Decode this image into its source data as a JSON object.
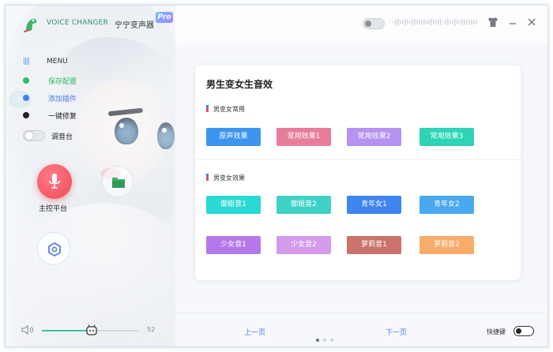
{
  "titlebar": {
    "app_name": "VOICE CHANGER",
    "app_cn": "宁宁变声器",
    "badge": "Pro",
    "top_toggle_on": false
  },
  "sidebar": {
    "menu_label": "MENU",
    "items": [
      {
        "label": "保存配置",
        "color": "#2dbb69"
      },
      {
        "label": "添加插件",
        "color": "#4c7cf0"
      },
      {
        "label": "一键修复",
        "color": "#222222"
      }
    ],
    "mixer_label": "调音台",
    "mixer_on": false,
    "main_control_label": "主控平台"
  },
  "volume": {
    "value": 52,
    "fill_fraction": 0.52
  },
  "panel": {
    "title": "男生变女生音效",
    "section1_title": "男变女常用",
    "section1_buttons": [
      {
        "label": "原声效果",
        "color": "#3d95f0"
      },
      {
        "label": "常用效果1",
        "color": "#e87d9a"
      },
      {
        "label": "常用效果2",
        "color": "#b693f0"
      },
      {
        "label": "常用效果3",
        "color": "#2fd3b5"
      }
    ],
    "section2_title": "男变女效果",
    "section2_buttons": [
      {
        "label": "御姐音1",
        "color": "#29d9d3"
      },
      {
        "label": "御姐音2",
        "color": "#3fd2c6"
      },
      {
        "label": "青年女1",
        "color": "#3f85f0"
      },
      {
        "label": "青年女2",
        "color": "#4aa8ee"
      },
      {
        "label": "少女音1",
        "color": "#b578ea"
      },
      {
        "label": "少女音2",
        "color": "#d39be9"
      },
      {
        "label": "萝莉音1",
        "color": "#c9736a"
      },
      {
        "label": "萝莉音2",
        "color": "#f7ac6c"
      }
    ]
  },
  "footer": {
    "prev_label": "上一页",
    "next_label": "下一页",
    "page_count": 3,
    "current_page": 1,
    "hotkey_label": "快捷键",
    "hotkey_on": false
  }
}
